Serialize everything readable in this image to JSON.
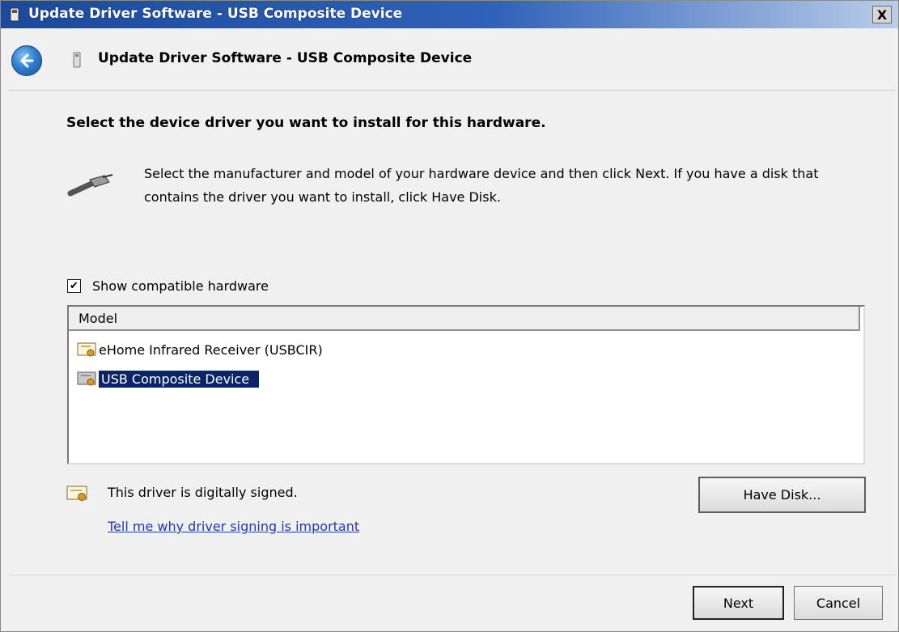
{
  "window": {
    "title": "Update Driver Software - USB Composite Device",
    "close_label": "X"
  },
  "header": {
    "title": "Update Driver Software - USB Composite Device"
  },
  "main": {
    "heading": "Select the device driver you want to install for this hardware.",
    "instruction": "Select the manufacturer and model of your hardware device and then click Next. If you have a disk that contains the driver you want to install, click Have Disk.",
    "show_compatible": {
      "label": "Show compatible hardware",
      "checked": true,
      "check_glyph": "✔"
    },
    "list": {
      "column_header": "Model",
      "items": [
        {
          "label": "eHome Infrared Receiver (USBCIR)",
          "selected": false,
          "icon": "certificate-icon"
        },
        {
          "label": "USB Composite Device",
          "selected": true,
          "icon": "certificate-icon"
        }
      ]
    },
    "signed_text": "This driver is digitally signed.",
    "signing_link": "Tell me why driver signing is important",
    "have_disk_label": "Have Disk..."
  },
  "footer": {
    "next_label": "Next",
    "cancel_label": "Cancel"
  },
  "colors": {
    "title_bar": "#1b4a9c",
    "selection": "#0a246a",
    "link": "#1f38b7"
  }
}
